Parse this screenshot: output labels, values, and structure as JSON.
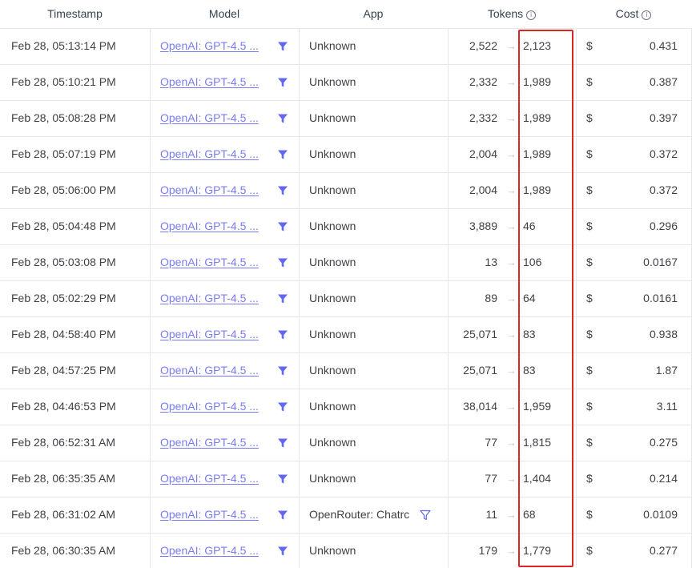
{
  "columns": {
    "timestamp": "Timestamp",
    "model": "Model",
    "app": "App",
    "tokens": "Tokens",
    "cost": "Cost"
  },
  "info_icon_glyph": "i",
  "currency_symbol": "$",
  "arrow_glyph": "→",
  "rows": [
    {
      "timestamp": "Feb 28, 05:13:14 PM",
      "model": "OpenAI: GPT-4.5 ...",
      "app": "Unknown",
      "tokens_in": "2,522",
      "tokens_out": "2,123",
      "cost": "0.431"
    },
    {
      "timestamp": "Feb 28, 05:10:21 PM",
      "model": "OpenAI: GPT-4.5 ...",
      "app": "Unknown",
      "tokens_in": "2,332",
      "tokens_out": "1,989",
      "cost": "0.387"
    },
    {
      "timestamp": "Feb 28, 05:08:28 PM",
      "model": "OpenAI: GPT-4.5 ...",
      "app": "Unknown",
      "tokens_in": "2,332",
      "tokens_out": "1,989",
      "cost": "0.397"
    },
    {
      "timestamp": "Feb 28, 05:07:19 PM",
      "model": "OpenAI: GPT-4.5 ...",
      "app": "Unknown",
      "tokens_in": "2,004",
      "tokens_out": "1,989",
      "cost": "0.372"
    },
    {
      "timestamp": "Feb 28, 05:06:00 PM",
      "model": "OpenAI: GPT-4.5 ...",
      "app": "Unknown",
      "tokens_in": "2,004",
      "tokens_out": "1,989",
      "cost": "0.372"
    },
    {
      "timestamp": "Feb 28, 05:04:48 PM",
      "model": "OpenAI: GPT-4.5 ...",
      "app": "Unknown",
      "tokens_in": "3,889",
      "tokens_out": "46",
      "cost": "0.296"
    },
    {
      "timestamp": "Feb 28, 05:03:08 PM",
      "model": "OpenAI: GPT-4.5 ...",
      "app": "Unknown",
      "tokens_in": "13",
      "tokens_out": "106",
      "cost": "0.0167"
    },
    {
      "timestamp": "Feb 28, 05:02:29 PM",
      "model": "OpenAI: GPT-4.5 ...",
      "app": "Unknown",
      "tokens_in": "89",
      "tokens_out": "64",
      "cost": "0.0161"
    },
    {
      "timestamp": "Feb 28, 04:58:40 PM",
      "model": "OpenAI: GPT-4.5 ...",
      "app": "Unknown",
      "tokens_in": "25,071",
      "tokens_out": "83",
      "cost": "0.938"
    },
    {
      "timestamp": "Feb 28, 04:57:25 PM",
      "model": "OpenAI: GPT-4.5 ...",
      "app": "Unknown",
      "tokens_in": "25,071",
      "tokens_out": "83",
      "cost": "1.87"
    },
    {
      "timestamp": "Feb 28, 04:46:53 PM",
      "model": "OpenAI: GPT-4.5 ...",
      "app": "Unknown",
      "tokens_in": "38,014",
      "tokens_out": "1,959",
      "cost": "3.11"
    },
    {
      "timestamp": "Feb 28, 06:52:31 AM",
      "model": "OpenAI: GPT-4.5 ...",
      "app": "Unknown",
      "tokens_in": "77",
      "tokens_out": "1,815",
      "cost": "0.275"
    },
    {
      "timestamp": "Feb 28, 06:35:35 AM",
      "model": "OpenAI: GPT-4.5 ...",
      "app": "Unknown",
      "tokens_in": "77",
      "tokens_out": "1,404",
      "cost": "0.214"
    },
    {
      "timestamp": "Feb 28, 06:31:02 AM",
      "model": "OpenAI: GPT-4.5 ...",
      "app": "OpenRouter: Chatrc",
      "app_filter_outline": true,
      "tokens_in": "11",
      "tokens_out": "68",
      "cost": "0.0109"
    },
    {
      "timestamp": "Feb 28, 06:30:35 AM",
      "model": "OpenAI: GPT-4.5 ...",
      "app": "Unknown",
      "tokens_in": "179",
      "tokens_out": "1,779",
      "cost": "0.277"
    }
  ],
  "colors": {
    "link": "#6366f1",
    "filter_icon": "#6366f1",
    "highlight": "#e02424",
    "grid": "#e5e7eb"
  },
  "icons": {
    "model_filter": "funnel-filled-icon",
    "app_filter": "funnel-outline-icon",
    "info": "info-circle-icon"
  }
}
